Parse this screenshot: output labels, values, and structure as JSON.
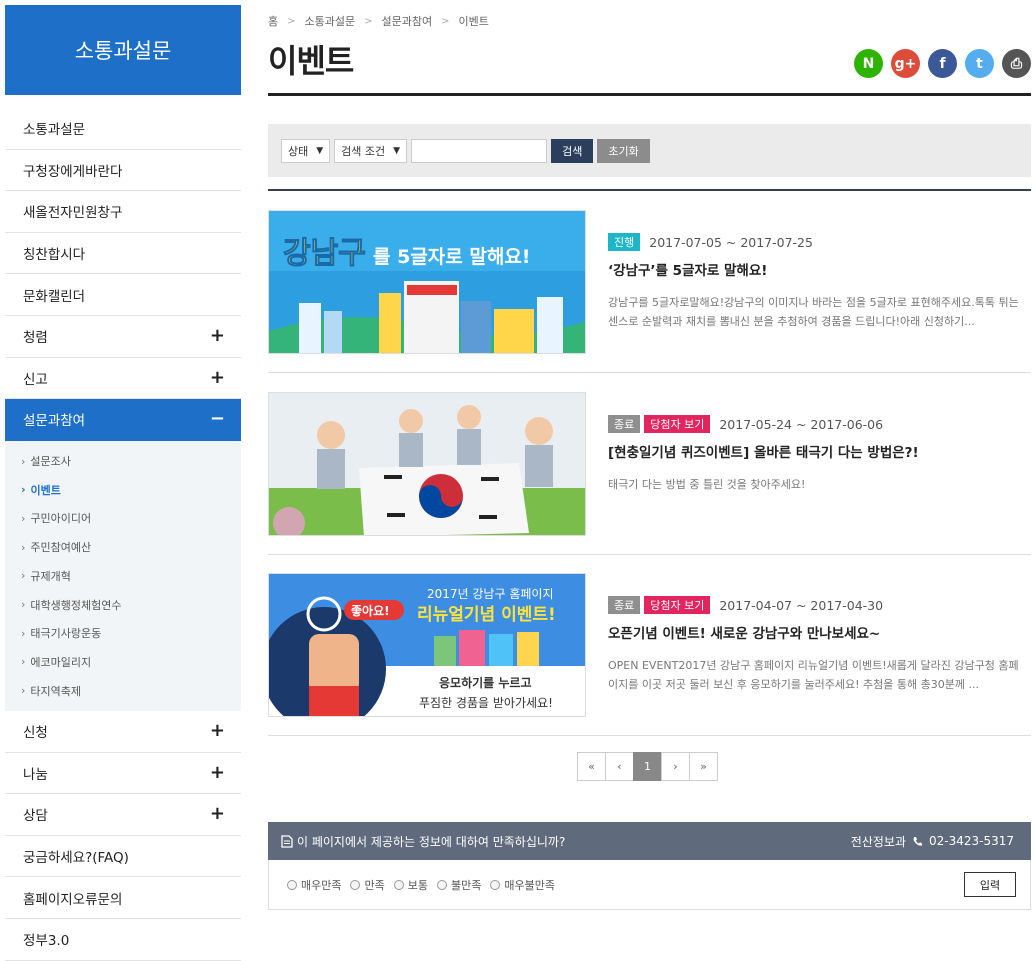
{
  "sidebar": {
    "title": "소통과설문",
    "menu_top": [
      {
        "label": "소통과설문",
        "plus": ""
      },
      {
        "label": "구청장에게바란다",
        "plus": ""
      },
      {
        "label": "새올전자민원창구",
        "plus": ""
      },
      {
        "label": "칭찬합시다",
        "plus": ""
      },
      {
        "label": "문화캘린더",
        "plus": ""
      },
      {
        "label": "청렴",
        "plus": "+"
      },
      {
        "label": "신고",
        "plus": "+"
      }
    ],
    "active": {
      "label": "설문과참여",
      "minus": "−"
    },
    "submenu": [
      {
        "label": "설문조사"
      },
      {
        "label": "이벤트"
      },
      {
        "label": "구민아이디어"
      },
      {
        "label": "주민참여예산"
      },
      {
        "label": "규제개혁"
      },
      {
        "label": "대학생행정체험연수"
      },
      {
        "label": "태극기사랑운동"
      },
      {
        "label": "에코마일리지"
      },
      {
        "label": "타지역축제"
      }
    ],
    "submenu_arrow": "›",
    "menu_bottom": [
      {
        "label": "신청",
        "plus": "+"
      },
      {
        "label": "나눔",
        "plus": "+"
      },
      {
        "label": "상담",
        "plus": "+"
      },
      {
        "label": "궁금하세요?(FAQ)",
        "plus": ""
      },
      {
        "label": "홈페이지오류문의",
        "plus": ""
      },
      {
        "label": "정부3.0",
        "plus": ""
      }
    ]
  },
  "breadcrumb": [
    "홈",
    "소통과설문",
    "설문과참여",
    "이벤트"
  ],
  "breadcrumb_sep": ">",
  "page_title": "이벤트",
  "share": [
    {
      "icon": "naver-icon",
      "glyph": "N",
      "color": "#2db400"
    },
    {
      "icon": "googleplus-icon",
      "glyph": "g+",
      "color": "#dd4b39"
    },
    {
      "icon": "facebook-icon",
      "glyph": "f",
      "color": "#3b5998"
    },
    {
      "icon": "twitter-icon",
      "glyph": "t",
      "color": "#55acee"
    },
    {
      "icon": "print-icon",
      "glyph": "⎙",
      "color": "#555555"
    }
  ],
  "search": {
    "status_select": "상태",
    "condition_select": "검색 조건",
    "caret": "▼",
    "search_label": "검색",
    "reset_label": "초기화"
  },
  "events": [
    {
      "badges": [
        {
          "text": "진행",
          "kind": "ongoing"
        }
      ],
      "period": "2017-07-05 ~ 2017-07-25",
      "title": "‘강남구’를 5글자로 말해요!",
      "desc": "강남구를 5글자로말해요!강남구의 이미지나 바라는 점을 5글자로 표현해주세요.톡톡 튀는 센스로 순발력과 재치를 뽐내신 분을 추첨하여 경품을 드립니다!아래 신청하기...",
      "thumb_text": [
        "강남구",
        "를 5글자로 말해요!"
      ]
    },
    {
      "badges": [
        {
          "text": "종료",
          "kind": "closed"
        },
        {
          "text": "당첨자 보기",
          "kind": "winner"
        }
      ],
      "period": "2017-05-24 ~ 2017-06-06",
      "title": "[현충일기념 퀴즈이벤트] 올바른 태극기 다는 방법은?!",
      "desc": "태극기 다는 방법 중 틀린 것을 찾아주세요!"
    },
    {
      "badges": [
        {
          "text": "종료",
          "kind": "closed"
        },
        {
          "text": "당첨자 보기",
          "kind": "winner"
        }
      ],
      "period": "2017-04-07 ~ 2017-04-30",
      "title": "오픈기념 이벤트! 새로운 강남구와 만나보세요~",
      "desc": "OPEN EVENT2017년 강남구 홈페이지 리뉴얼기념 이벤트!새롭게 달라진 강남구청 홈페이지를 이곳 저곳 둘러 보신 후 응모하기를 눌러주세요! 추첨을 통해 총30분께 ...",
      "thumb_text": [
        "2017년 강남구 홈페이지",
        "리뉴얼기념 이벤트!",
        "좋아요!",
        "응모하기를 누르고",
        "푸짐한 경품을 받아가세요!"
      ]
    }
  ],
  "pagination": {
    "first": "«",
    "prev": "‹",
    "current": "1",
    "next": "›",
    "last": "»"
  },
  "survey": {
    "question": "이 페이지에서 제공하는 정보에 대하여 만족하십니까?",
    "dept": "전산정보과",
    "phone": "02-3423-5317",
    "options": [
      "매우만족",
      "만족",
      "보통",
      "불만족",
      "매우불만족"
    ],
    "submit_label": "입력"
  }
}
